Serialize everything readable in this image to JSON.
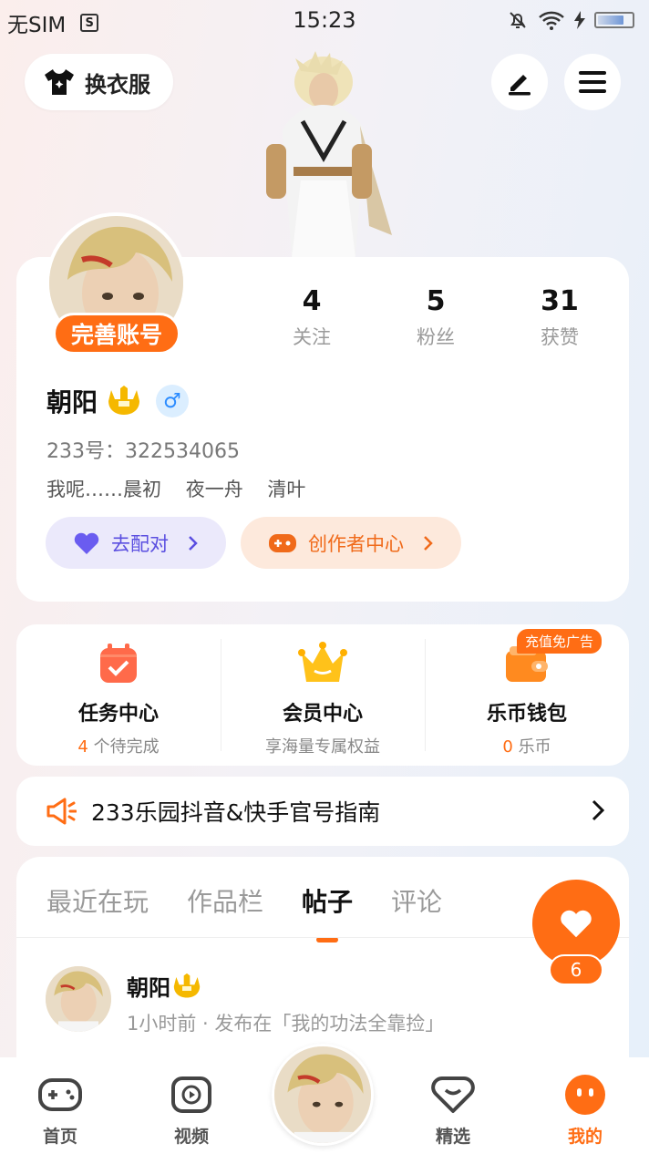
{
  "status_bar": {
    "carrier": "无SIM",
    "time": "15:23"
  },
  "header": {
    "wardrobe_label": "换衣服"
  },
  "profile": {
    "complete_label": "完善账号",
    "stats": [
      {
        "value": "4",
        "label": "关注"
      },
      {
        "value": "5",
        "label": "粉丝"
      },
      {
        "value": "31",
        "label": "获赞"
      }
    ],
    "username": "朝阳",
    "gender_symbol": "♂",
    "uid": "233号：322534065",
    "bio": "我呢……晨初    夜一舟    清叶",
    "match_label": "去配对",
    "creator_label": "创作者中心"
  },
  "services": [
    {
      "title": "任务中心",
      "sub_highlight": "4",
      "sub_rest": " 个待完成"
    },
    {
      "title": "会员中心",
      "sub_highlight": "",
      "sub_rest": "享海量专属权益"
    },
    {
      "title": "乐币钱包",
      "sub_highlight": "0",
      "sub_rest": " 乐币",
      "badge": "充值免广告"
    }
  ],
  "announcement": {
    "text": "233乐园抖音&快手官号指南"
  },
  "tabs": [
    "最近在玩",
    "作品栏",
    "帖子",
    "评论"
  ],
  "active_tab": "帖子",
  "post": {
    "author": "朝阳",
    "meta": "1小时前 · 发布在「我的功法全靠捡」"
  },
  "like_count": "6",
  "bottom_nav": [
    {
      "label": "首页"
    },
    {
      "label": "视频"
    },
    {
      "label": "精选"
    },
    {
      "label": "我的"
    }
  ],
  "colors": {
    "accent": "#ff6d14",
    "match": "#5a4ee0",
    "gender": "#2c8cff"
  }
}
